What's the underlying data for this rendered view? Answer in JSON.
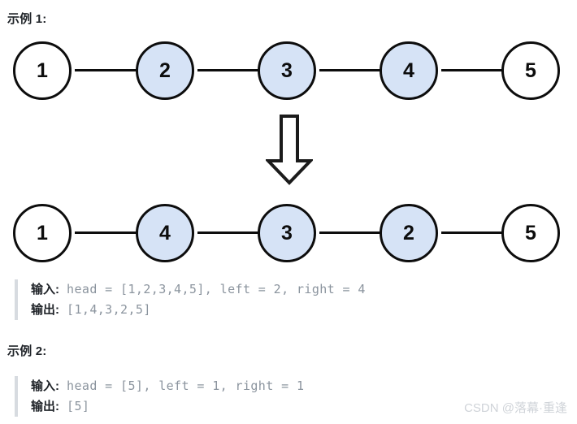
{
  "colors": {
    "node_fill_highlight": "#d6e3f6",
    "node_fill_plain": "#ffffff",
    "node_stroke": "#0d0d0d",
    "arrow": "#0d0d0d",
    "quote_bar": "#d7dbe0",
    "code_text": "#8b949e",
    "heading_text": "#1f2328",
    "watermark": "#cfd3d8"
  },
  "headings": {
    "example1": "示例 1:",
    "example2": "示例 2:"
  },
  "diagram": {
    "input_row": {
      "name": "input-linked-list",
      "nodes": [
        {
          "value": "1",
          "highlight": false
        },
        {
          "value": "2",
          "highlight": true
        },
        {
          "value": "3",
          "highlight": true
        },
        {
          "value": "4",
          "highlight": true
        },
        {
          "value": "5",
          "highlight": false
        }
      ]
    },
    "transform_arrow": "down-arrow",
    "output_row": {
      "name": "output-linked-list",
      "nodes": [
        {
          "value": "1",
          "highlight": false
        },
        {
          "value": "4",
          "highlight": true
        },
        {
          "value": "3",
          "highlight": true
        },
        {
          "value": "2",
          "highlight": true
        },
        {
          "value": "5",
          "highlight": false
        }
      ]
    }
  },
  "example1": {
    "input_label": "输入:",
    "input_value": "head = [1,2,3,4,5], left = 2, right = 4",
    "output_label": "输出:",
    "output_value": "[1,4,3,2,5]"
  },
  "example2": {
    "input_label": "输入:",
    "input_value": "head = [5], left = 1, right = 1",
    "output_label": "输出:",
    "output_value": "[5]"
  },
  "watermark": "CSDN @落幕·重逢"
}
